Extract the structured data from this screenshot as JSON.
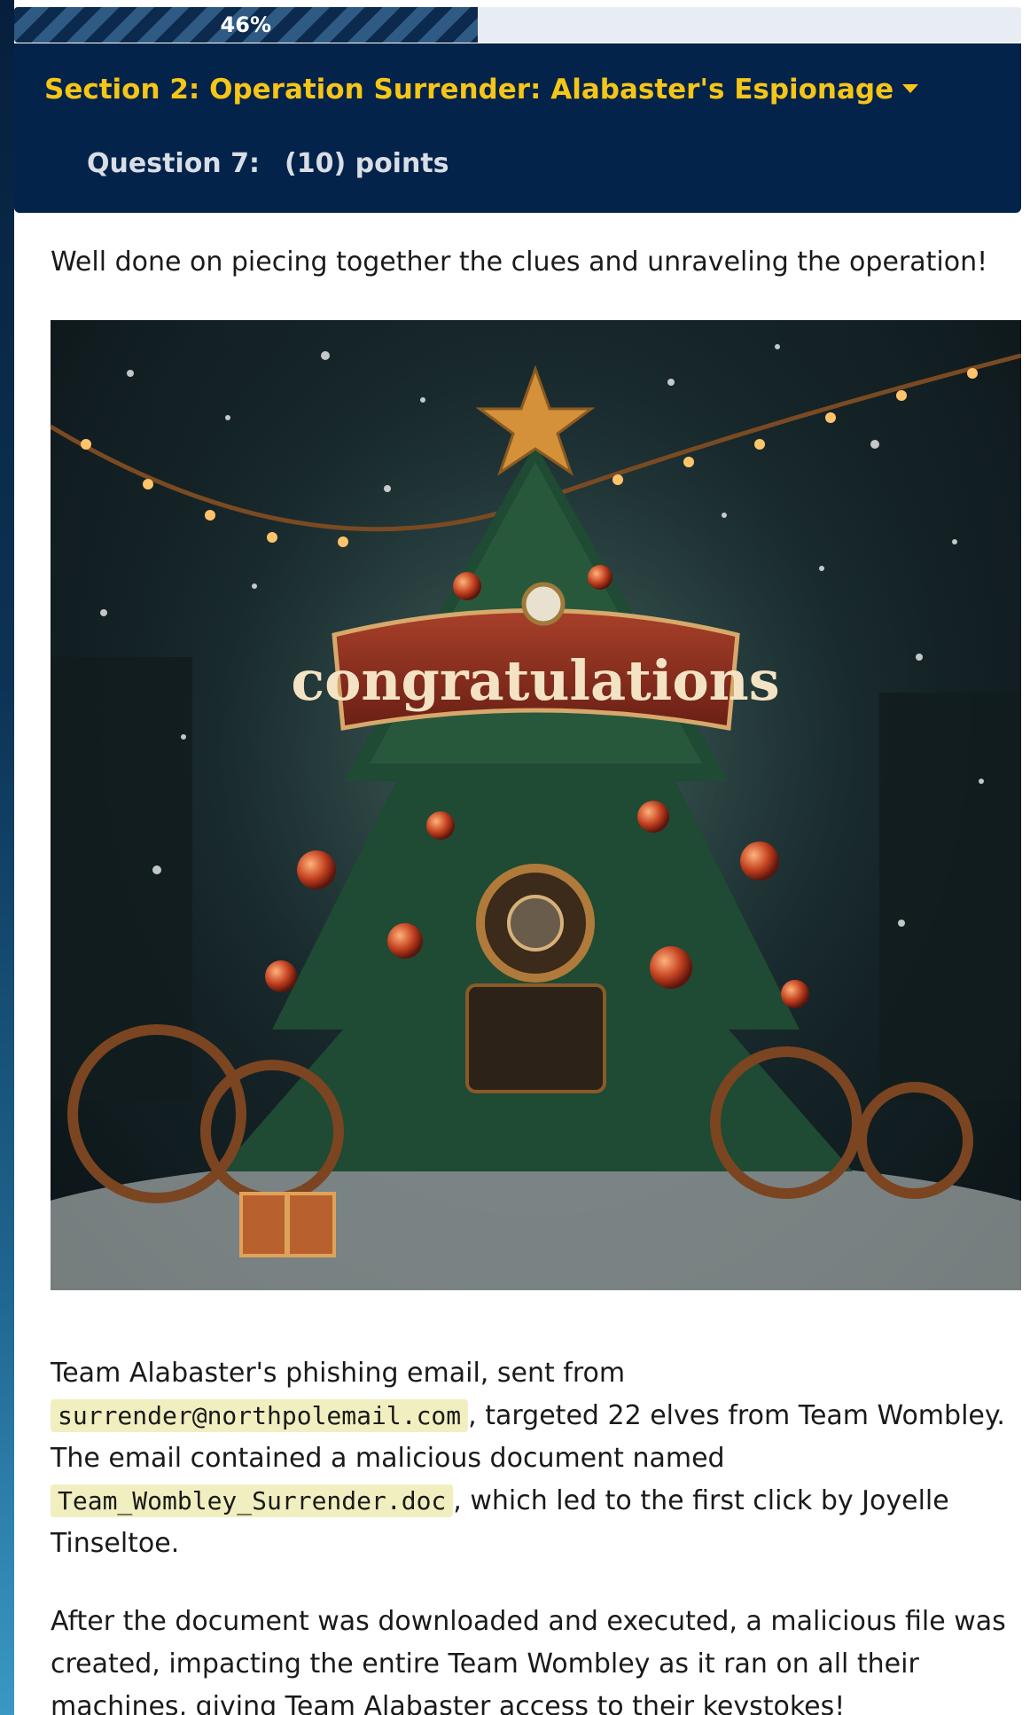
{
  "progress": {
    "value": 0.46,
    "label": "46%"
  },
  "section": {
    "title": "Section 2: Operation Surrender: Alabaster's Espionage",
    "question_label": "Question 7:",
    "points_label": "(10) points"
  },
  "content": {
    "intro": "Well done on piecing together the clues and unraveling the operation!",
    "image": {
      "banner_text": "congratulations",
      "alt_icon": "christmas-tree-illustration"
    },
    "para1": {
      "t1": "Team Alabaster's phishing email, sent from ",
      "code1": "surrender@northpolemail.com",
      "t2": ", targeted 22 elves from Team Wombley. The email contained a malicious document named ",
      "code2": "Team_Wombley_Surrender.doc",
      "t3": ", which led to the first click by Joyelle Tinseltoe."
    },
    "para2": "After the document was downloaded and executed, a malicious file was created, impacting the entire Team Wombley as it ran on all their machines, giving Team Alabaster access to their keystokes!"
  },
  "colors": {
    "header_bg": "#04234a",
    "title_accent": "#f5c518",
    "code_bg": "#f1efc0"
  }
}
